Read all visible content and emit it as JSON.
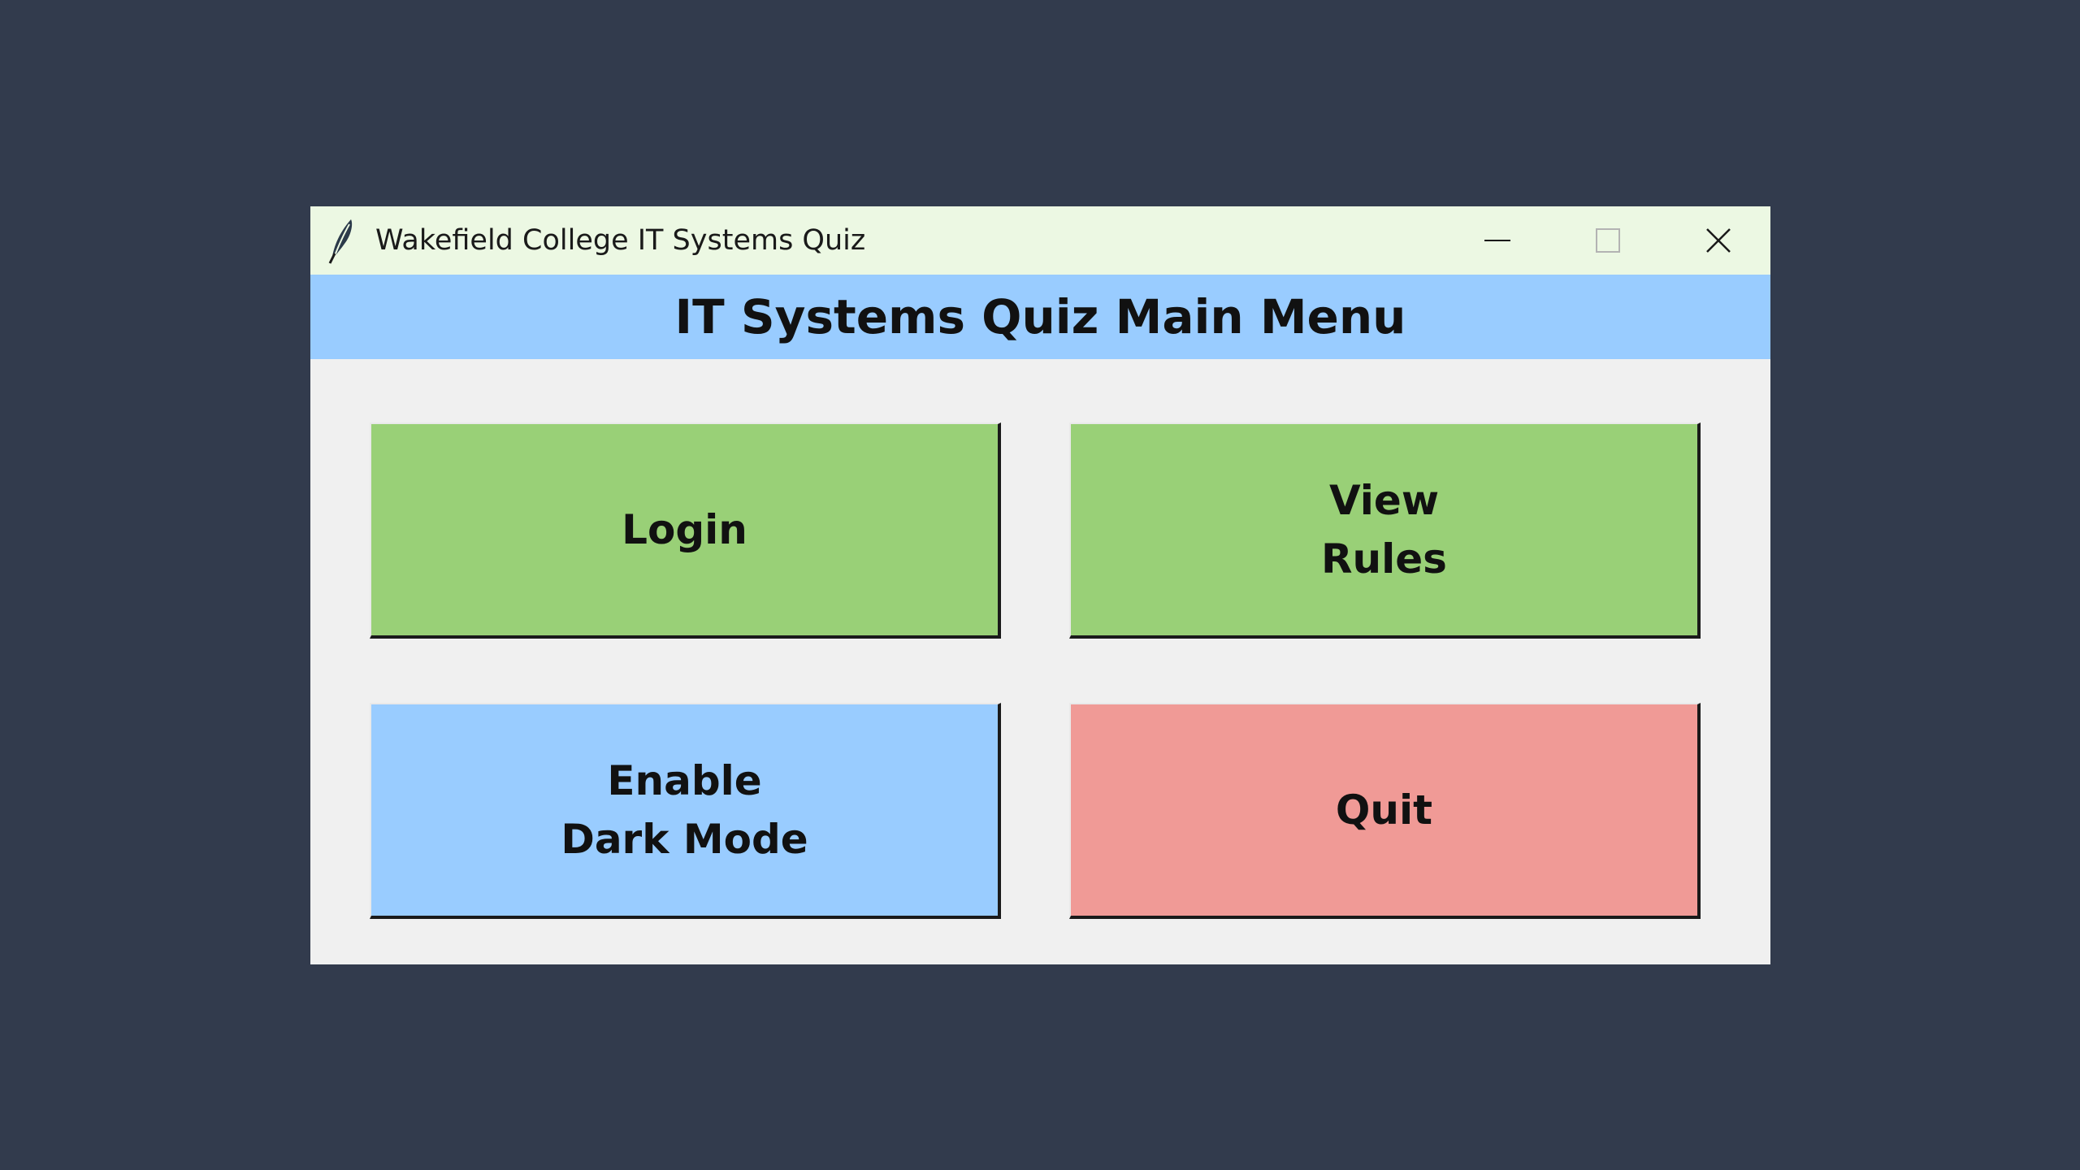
{
  "window": {
    "title": "Wakefield College IT Systems Quiz",
    "icon": "feather-icon",
    "controls": {
      "minimize": "minimize-icon",
      "maximize": "maximize-icon",
      "close": "close-icon"
    }
  },
  "header": {
    "title": "IT Systems Quiz Main Menu",
    "background": "#99ccff"
  },
  "buttons": {
    "login": {
      "label": "Login",
      "color": "#99d077"
    },
    "rules": {
      "label": "View\nRules",
      "color": "#99d077"
    },
    "dark_mode": {
      "label": "Enable\nDark Mode",
      "color": "#99ccff"
    },
    "quit": {
      "label": "Quit",
      "color": "#f09a96"
    }
  },
  "colors": {
    "desktop": "#323b4d",
    "titlebar": "#ecf8e3",
    "window_body": "#f0f0f0"
  }
}
